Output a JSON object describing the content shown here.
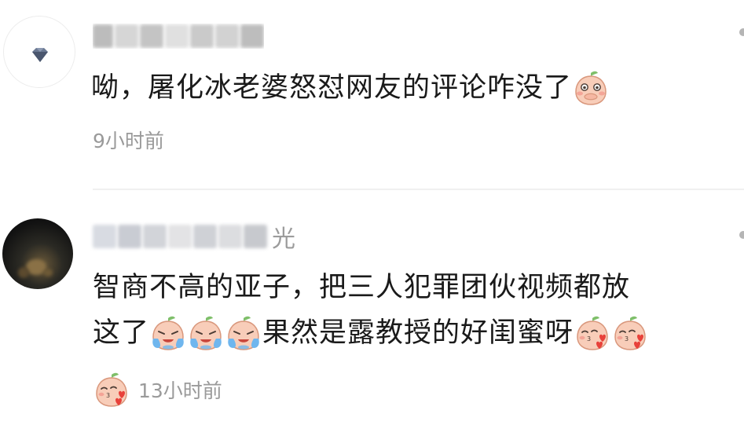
{
  "comments": [
    {
      "username_visible": "",
      "text": "呦，屠化冰老婆怒怼网友的评论咋没了",
      "emojis": [
        "peach-shy-emoji"
      ],
      "time": "9小时前"
    },
    {
      "username_visible": "光",
      "text_line1": "智商不高的亚子，把三人犯罪团伙视频都放",
      "text_line2_a": "这了",
      "text_line2_b": "果然是露教授的好闺蜜呀",
      "emojis_after_a": [
        "peach-crying-emoji",
        "peach-crying-emoji",
        "peach-crying-emoji"
      ],
      "emojis_after_b": [
        "peach-kiss-emoji",
        "peach-kiss-emoji"
      ],
      "emojis_line3": [
        "peach-kiss-emoji"
      ],
      "time": "13小时前"
    }
  ],
  "colors": {
    "text": "#1a1a1a",
    "meta": "#9a9a9a",
    "divider": "#f0f0f0",
    "peach": "#f6c9b6",
    "peach_cheek": "#f08a80",
    "leaf": "#7fbf6a"
  }
}
